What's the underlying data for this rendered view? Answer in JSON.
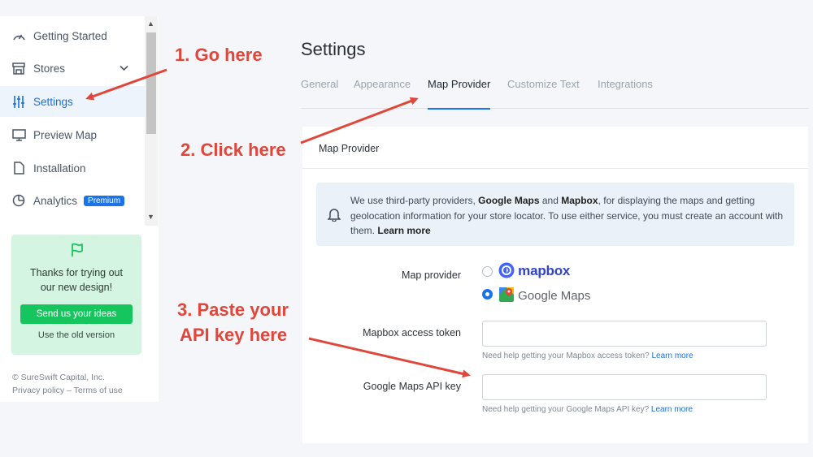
{
  "sidebar": {
    "items": [
      {
        "label": "Getting Started",
        "icon": "gauge-icon"
      },
      {
        "label": "Stores",
        "icon": "store-icon"
      },
      {
        "label": "Settings",
        "icon": "sliders-icon"
      },
      {
        "label": "Preview Map",
        "icon": "monitor-icon"
      },
      {
        "label": "Installation",
        "icon": "document-icon"
      },
      {
        "label": "Analytics",
        "icon": "pie-chart-icon",
        "badge": "Premium"
      }
    ],
    "promo": {
      "message_line1": "Thanks for trying out",
      "message_line2": "our new design!",
      "button": "Send us your ideas",
      "link": "Use the old version"
    },
    "footer": {
      "copyright": "© SureSwift Capital, Inc.",
      "privacy": "Privacy policy",
      "separator": " – ",
      "terms": "Terms of use"
    }
  },
  "page": {
    "title": "Settings",
    "tabs": [
      "General",
      "Appearance",
      "Map Provider",
      "Customize Text",
      "Integrations"
    ],
    "active_tab": "Map Provider"
  },
  "card": {
    "title": "Map Provider",
    "notice": {
      "t1": "We use third-party providers, ",
      "b1": "Google Maps",
      "t2": " and ",
      "b2": "Mapbox",
      "t3": ", for displaying the maps and getting geolocation information for your store locator. To use either service, you must create an account with them. ",
      "b3": "Learn more"
    },
    "map_provider": {
      "label": "Map provider",
      "options": [
        "mapbox",
        "Google Maps"
      ],
      "selected": "Google Maps"
    },
    "mapbox_token": {
      "label": "Mapbox access token",
      "value": "",
      "help": "Need help getting your Mapbox access token? ",
      "help_link": "Learn more"
    },
    "google_key": {
      "label": "Google Maps API key",
      "value": "",
      "help": "Need help getting your Google Maps API key? ",
      "help_link": "Learn more"
    }
  },
  "annotations": {
    "step1": "1. Go here",
    "step2": "2. Click here",
    "step3_line1": "3. Paste your",
    "step3_line2": "API key here"
  },
  "colors": {
    "accent": "#1a73e8",
    "annotation": "#e0463a",
    "promo_bg": "#d4f5e2",
    "promo_button": "#17c55e"
  }
}
